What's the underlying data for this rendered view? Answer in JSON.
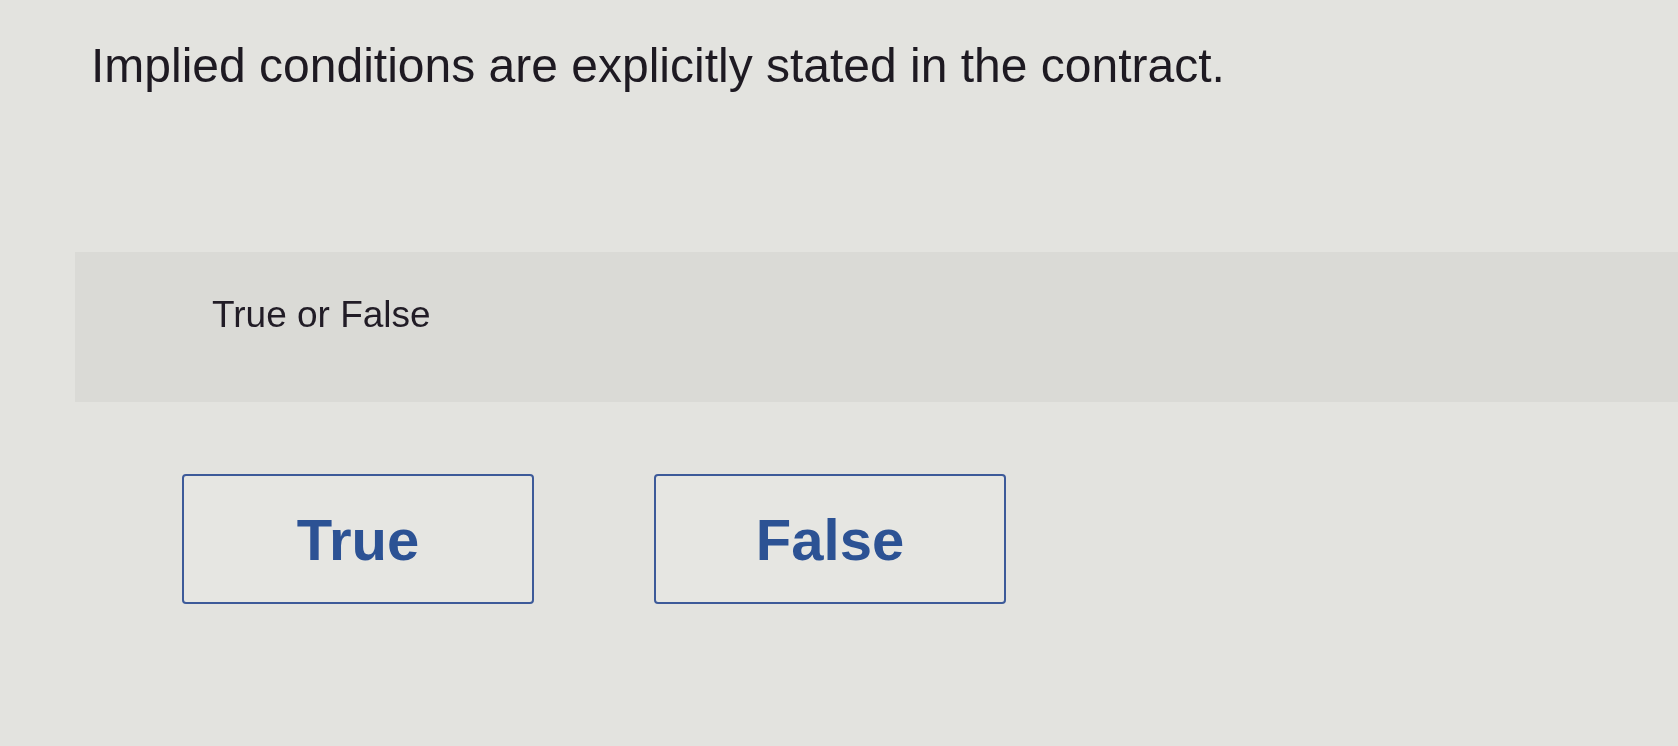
{
  "question": "Implied conditions are explicitly stated in the contract.",
  "prompt": "True or False",
  "options": [
    "True",
    "False"
  ]
}
